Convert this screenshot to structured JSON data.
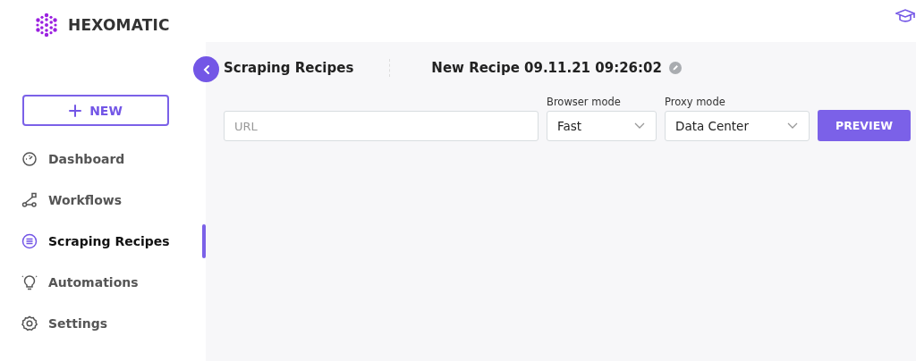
{
  "brand": {
    "name": "HEXOMATIC"
  },
  "new_button": {
    "label": "NEW"
  },
  "nav": [
    {
      "label": "Dashboard",
      "kind": "gauge",
      "selected": false
    },
    {
      "label": "Workflows",
      "kind": "flow",
      "selected": false
    },
    {
      "label": "Scraping Recipes",
      "kind": "list",
      "selected": true
    },
    {
      "label": "Automations",
      "kind": "bulb",
      "selected": false
    },
    {
      "label": "Settings",
      "kind": "gear",
      "selected": false
    }
  ],
  "header": {
    "section": "Scraping Recipes",
    "recipe_title": "New Recipe 09.11.21 09:26:02"
  },
  "form": {
    "url": {
      "placeholder": "URL"
    },
    "browser_mode": {
      "label": "Browser mode",
      "value": "Fast"
    },
    "proxy_mode": {
      "label": "Proxy mode",
      "value": "Data Center"
    },
    "preview_button": "PREVIEW"
  }
}
